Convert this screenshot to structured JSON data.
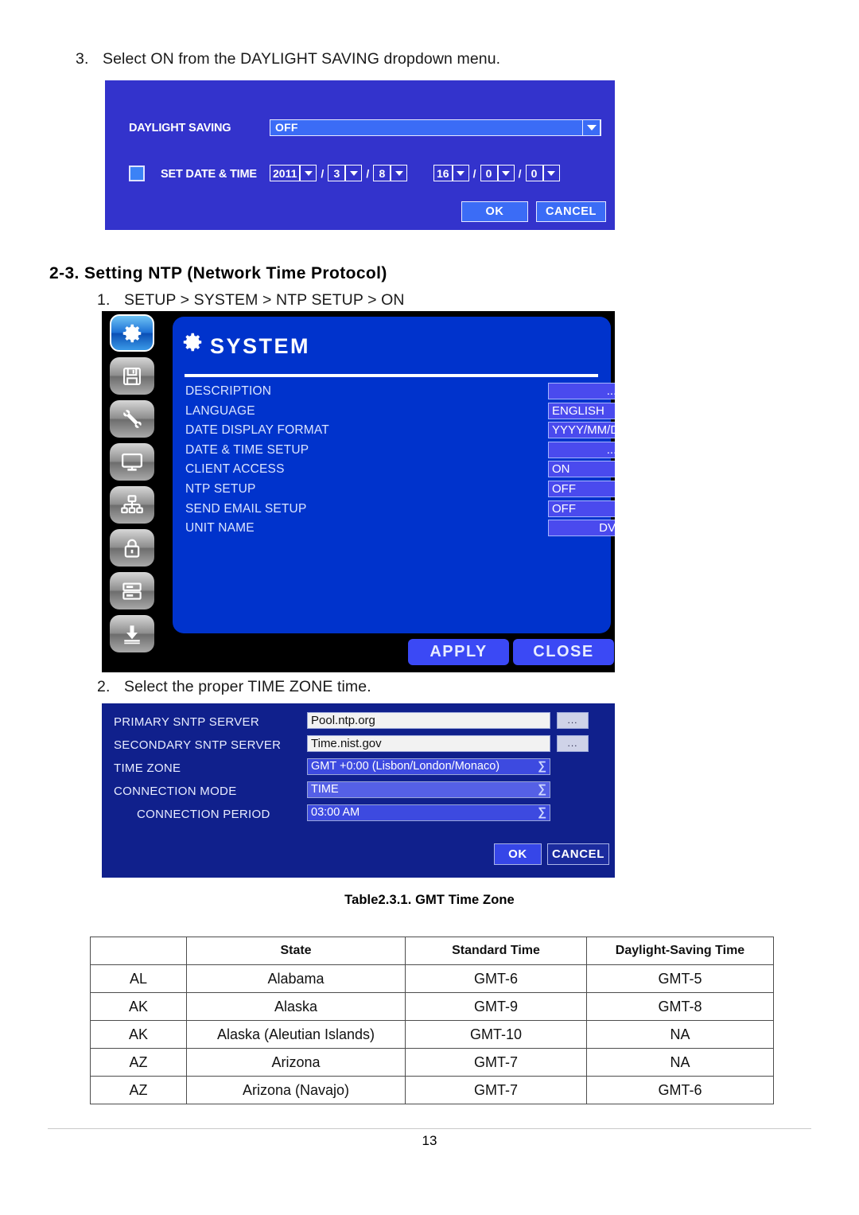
{
  "steps": {
    "step3": {
      "num": "3.",
      "text": "Select ON from the DAYLIGHT SAVING dropdown menu."
    },
    "step1": {
      "num": "1.",
      "text": "SETUP > SYSTEM > NTP SETUP > ON"
    },
    "step2": {
      "num": "2.",
      "text": "Select the proper TIME ZONE time."
    }
  },
  "heading": {
    "text": "2-3. Setting NTP (Network Time Protocol)"
  },
  "daylight_dialog": {
    "label_daylight": "DAYLIGHT SAVING",
    "value_daylight": "OFF",
    "label_set_datetime": "SET DATE & TIME",
    "date": {
      "year": "2011",
      "month": "3",
      "day": "8",
      "sep1": "/",
      "sep2": "/"
    },
    "time": {
      "hour": "16",
      "minute": "0",
      "second": "0",
      "sep1": "/",
      "sep2": "/"
    },
    "ok_label": "OK",
    "cancel_label": "CANCEL"
  },
  "system_menu": {
    "title": "SYSTEM",
    "rows": [
      {
        "name": "DESCRIPTION",
        "value": "...",
        "kind": "dots"
      },
      {
        "name": "LANGUAGE",
        "value": "ENGLISH",
        "kind": "select"
      },
      {
        "name": "DATE DISPLAY FORMAT",
        "value": "YYYY/MM/DD",
        "kind": "select"
      },
      {
        "name": "DATE & TIME SETUP",
        "value": "...",
        "kind": "dots"
      },
      {
        "name": "CLIENT ACCESS",
        "value": "ON",
        "kind": "select"
      },
      {
        "name": "NTP SETUP",
        "value": "OFF",
        "kind": "select-dots",
        "extra": "..."
      },
      {
        "name": "SEND EMAIL SETUP",
        "value": "OFF",
        "kind": "select-dots",
        "extra": "..."
      },
      {
        "name": "UNIT NAME",
        "value": "DVR",
        "kind": "text"
      }
    ],
    "apply_label": "APPLY",
    "close_label": "CLOSE",
    "icons": [
      "gear-icon",
      "floppy-disk-icon",
      "tools-icon",
      "monitor-icon",
      "network-icon",
      "lock-icon",
      "archive-icon",
      "download-icon"
    ]
  },
  "ntp_dialog": {
    "rows": [
      {
        "label": "PRIMARY SNTP SERVER",
        "value": "Pool.ntp.org",
        "kind": "input",
        "browse": "..."
      },
      {
        "label": "SECONDARY SNTP SERVER",
        "value": "Time.nist.gov",
        "kind": "input",
        "browse": "..."
      },
      {
        "label": "TIME ZONE",
        "value": "GMT +0:00 (Lisbon/London/Monaco)",
        "kind": "select"
      },
      {
        "label": "CONNECTION MODE",
        "value": "TIME",
        "kind": "select-light"
      },
      {
        "label": "CONNECTION PERIOD",
        "value": "03:00 AM",
        "kind": "select",
        "indent": true
      }
    ],
    "ok_label": "OK",
    "cancel_label": "CANCEL"
  },
  "table": {
    "caption": "Table2.3.1. GMT Time Zone",
    "headers": [
      "",
      "State",
      "Standard Time",
      "Daylight-Saving Time"
    ],
    "rows": [
      [
        "AL",
        "Alabama",
        "GMT-6",
        "GMT-5"
      ],
      [
        "AK",
        "Alaska",
        "GMT-9",
        "GMT-8"
      ],
      [
        "AK",
        "Alaska (Aleutian Islands)",
        "GMT-10",
        "NA"
      ],
      [
        "AZ",
        "Arizona",
        "GMT-7",
        "NA"
      ],
      [
        "AZ",
        "Arizona (Navajo)",
        "GMT-7",
        "GMT-6"
      ]
    ]
  },
  "footer": {
    "page_number": "13"
  },
  "colors": {
    "daylight_dialog_bg": "#3333CC",
    "system_panel_bg": "#0033CC",
    "ntp_dialog_bg": "#10208C",
    "field_blue": "#3B6CF6"
  }
}
